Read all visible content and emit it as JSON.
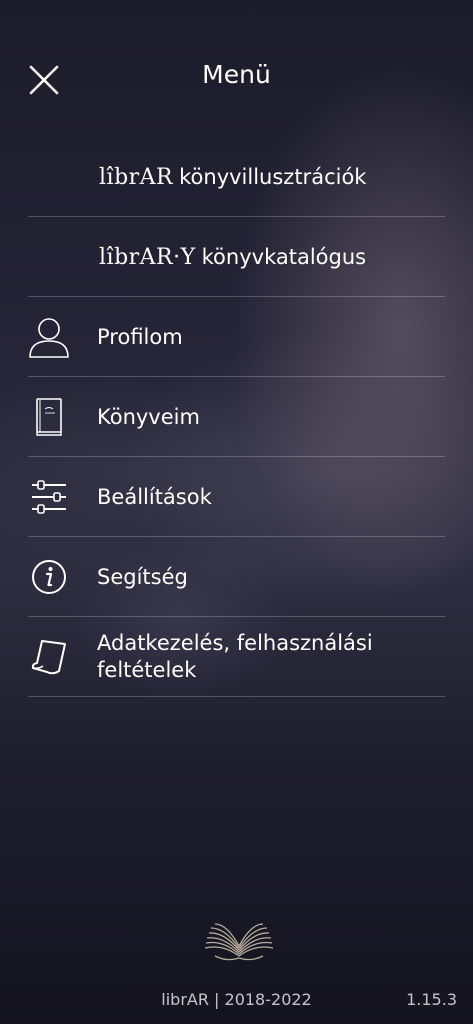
{
  "header": {
    "title": "Menü",
    "close_icon": "close-icon"
  },
  "menu": {
    "items": [
      {
        "logo": "lîbrAR",
        "label": "könyvillusztrációk",
        "icon": null
      },
      {
        "logo": "lîbrAR·Y",
        "label": "könyvkatalógus",
        "icon": null
      },
      {
        "label": "Profilom",
        "icon": "user-icon"
      },
      {
        "label": "Könyveim",
        "icon": "book-icon"
      },
      {
        "label": "Beállítások",
        "icon": "sliders-icon"
      },
      {
        "label": "Segítség",
        "icon": "info-icon"
      },
      {
        "label": "Adatkezelés, felhasználási feltételek",
        "icon": "document-icon"
      }
    ]
  },
  "footer": {
    "logo_icon": "open-book-logo-icon",
    "copyright": "librAR | 2018-2022",
    "version": "1.15.3"
  },
  "colors": {
    "text": "#ffffff",
    "divider": "rgba(255,255,255,0.22)",
    "background": "#23222f"
  }
}
